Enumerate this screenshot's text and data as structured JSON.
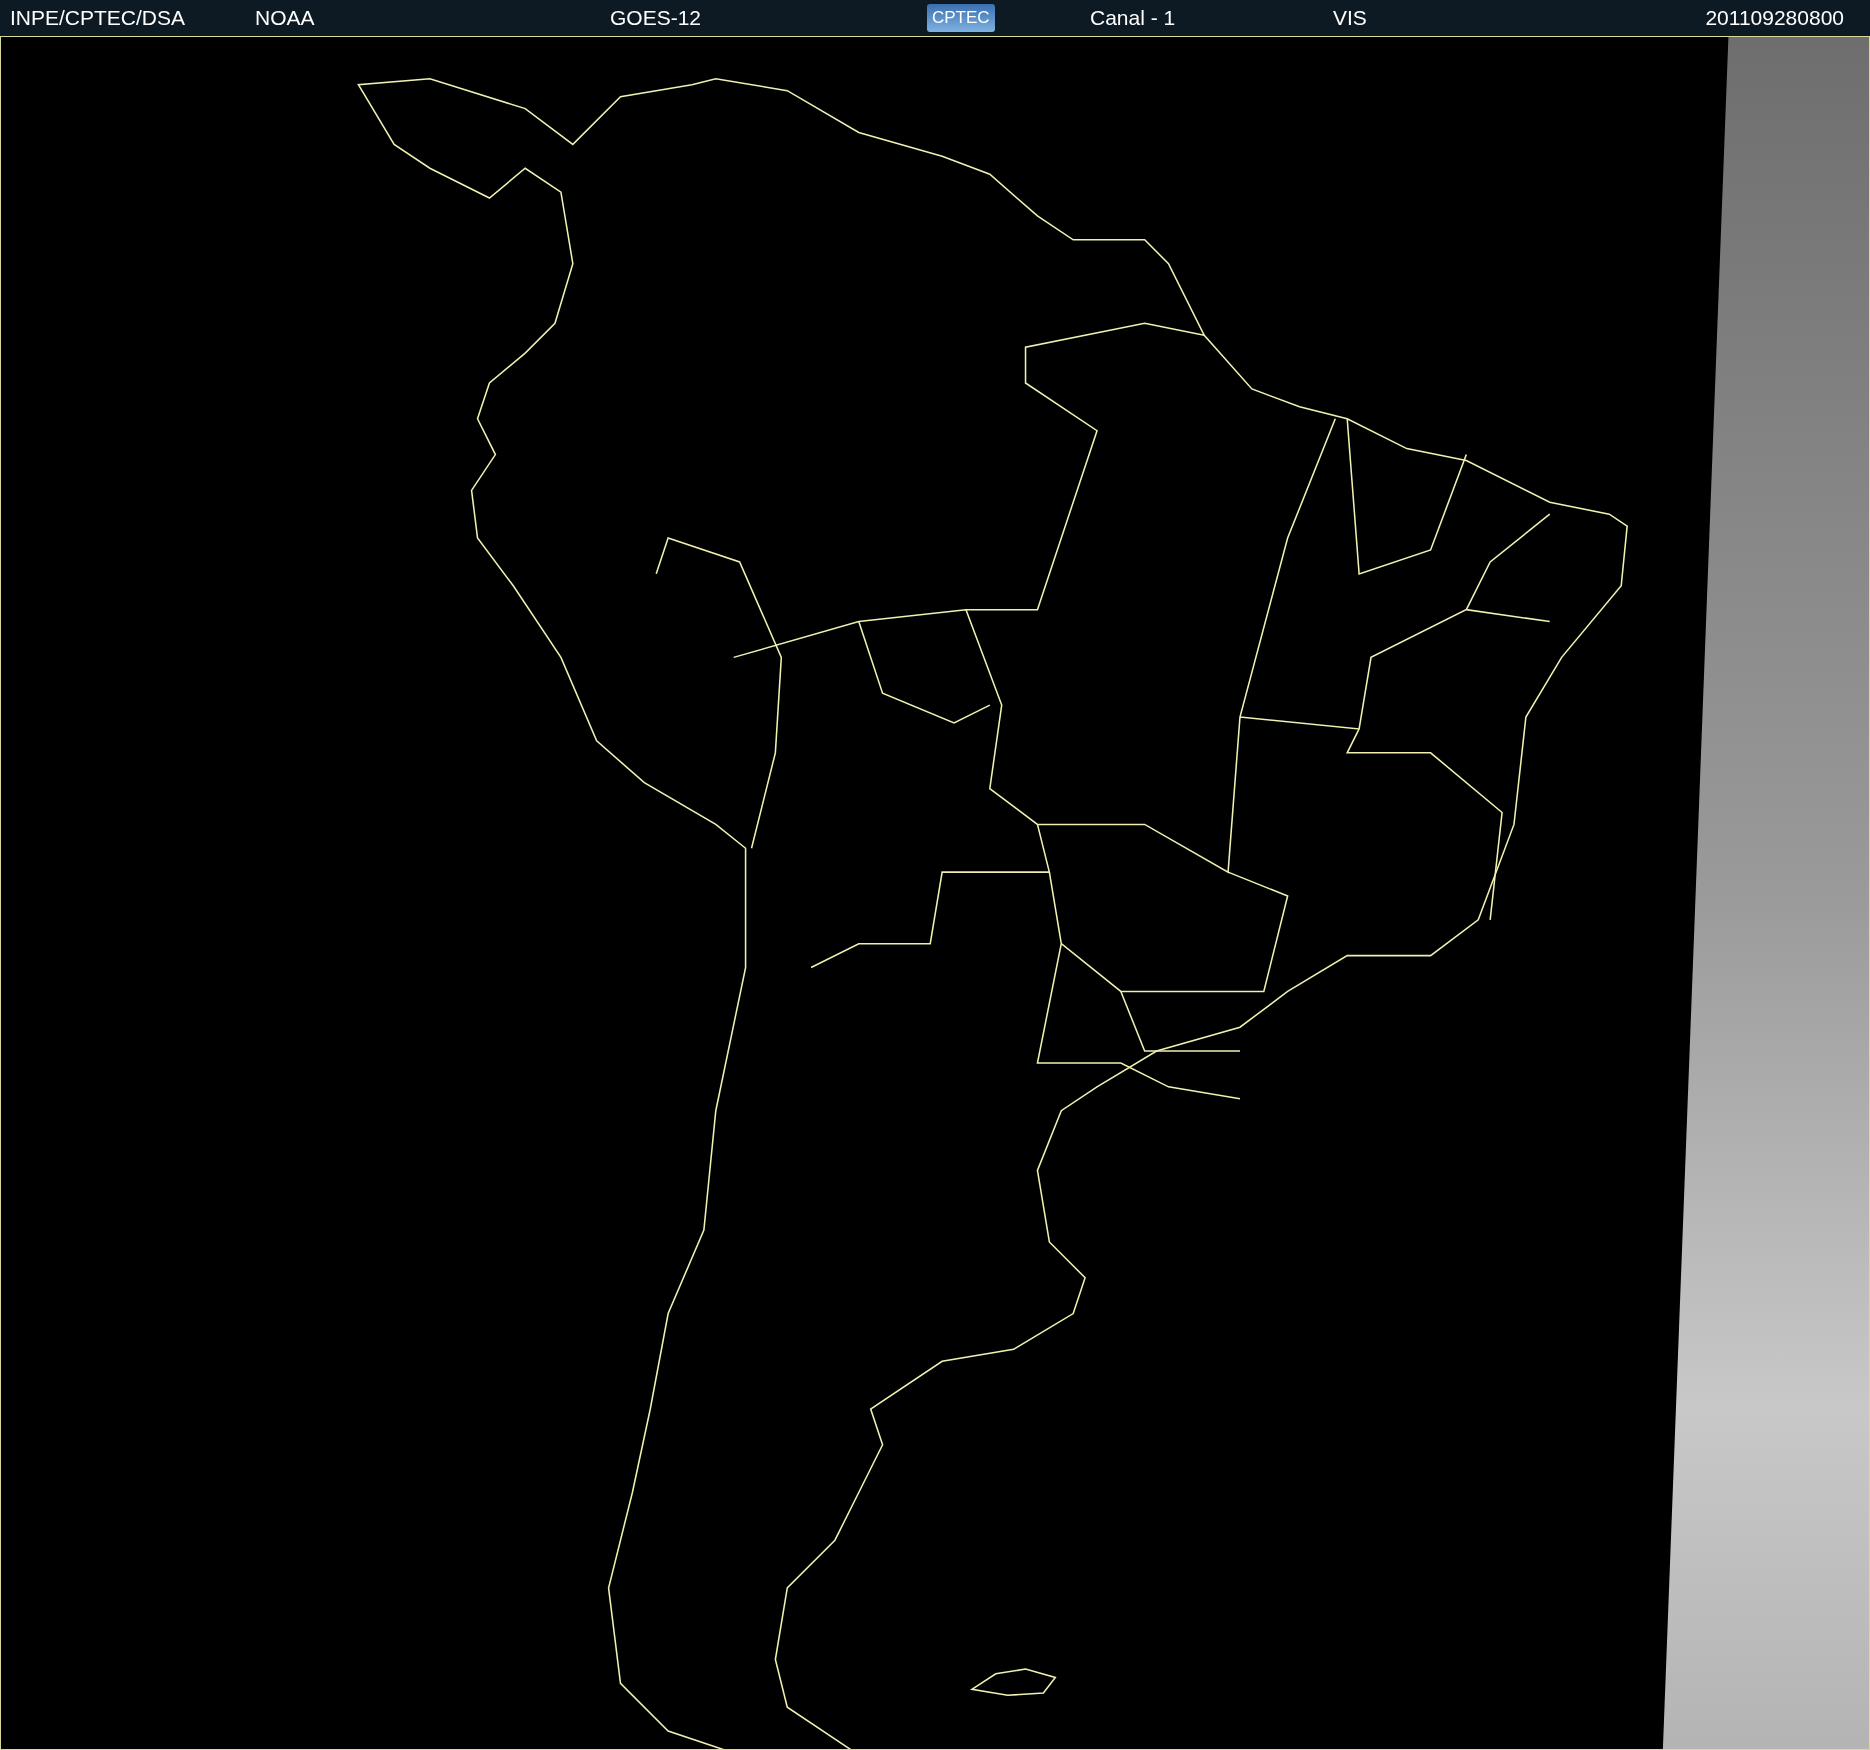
{
  "header": {
    "fields": [
      {
        "kind": "text",
        "text": "INPE/CPTEC/DSA"
      },
      {
        "kind": "text",
        "text": "NOAA"
      },
      {
        "kind": "text",
        "text": "GOES-12"
      },
      {
        "kind": "logo",
        "text": "CPTEC"
      },
      {
        "kind": "text",
        "text": "Canal - 1"
      },
      {
        "kind": "text",
        "text": "VIS"
      },
      {
        "kind": "text",
        "text": "201109280800"
      }
    ]
  }
}
